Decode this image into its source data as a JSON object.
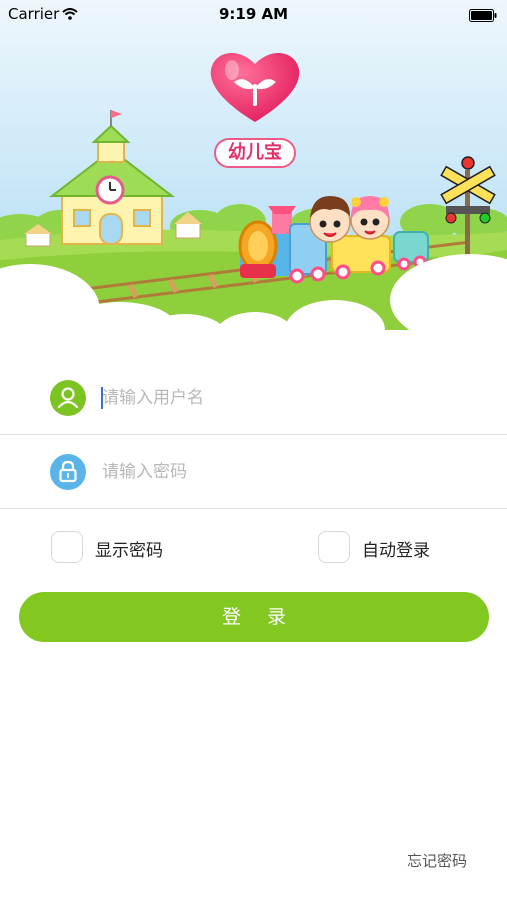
{
  "status_bar": {
    "carrier": "Carrier",
    "time": "9:19 AM"
  },
  "app": {
    "logo_text": "幼儿宝"
  },
  "form": {
    "username_placeholder": "请输入用户名",
    "password_placeholder": "请输入密码",
    "show_password_label": "显示密码",
    "auto_login_label": "自动登录",
    "login_button_label": "登 录",
    "forgot_password_label": "忘记密码"
  },
  "colors": {
    "accent_green": "#82c820",
    "user_icon_bg": "#7cc421",
    "lock_icon_bg": "#5ab4ea",
    "logo_pink": "#e2336b"
  }
}
